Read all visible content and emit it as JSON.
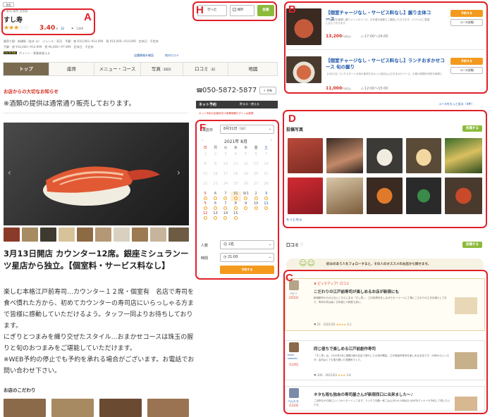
{
  "labels": {
    "A": "A",
    "B": "B",
    "C": "C",
    "D": "D",
    "F": "F",
    "H": "H"
  },
  "header": {
    "badge": "百名",
    "genre": "1 寿司 東京 百名店",
    "name": "すし寿",
    "rating": "3.40",
    "reviews": "32",
    "saves": "1489",
    "line1": "最寄り駅：新橋駅（徒歩 分）　ジャンル：寿司　予算：夜 ¥10,000～¥14,999　昼 ¥10,000～¥14,999　定休日：不定休",
    "line2": "予算：夜 ¥10,000～¥14,999　昼 ¥6,000～¥7,999　定休日：不定休",
    "goto": "Go To Eat",
    "points": "ポイント・食事券使える",
    "edit": "店舗情報を確認",
    "more": "他の口コミ"
  },
  "tabs": [
    {
      "label": "トップ"
    },
    {
      "label": "座席"
    },
    {
      "label": "メニュー・コース"
    },
    {
      "label": "写真",
      "count": "1022"
    },
    {
      "label": "口コミ",
      "count": "32"
    },
    {
      "label": "地図"
    }
  ],
  "notice": {
    "title": "お店からの大切なお知らせ",
    "body": "※酒類の提供は通常通り販売しております。"
  },
  "intro": {
    "title": "3月13日開店 カウンター12席。銀座ミシュランーツ星店から独立。【個室料・サービス料なし】",
    "body": "楽しむ本格江戸前寿司…カウンター１２席・個室有　名店で寿司を食べ慣れた方から、初めてカウンターの寿司店にいらっしゃる方まで皆様に感動していただけるよう。タッフ一同よりお待ちしております。\nにぎりとつまみを織り交ぜたスタイル…おまかせコースは珠玉の握りと旬のおつまみをご堪能していただけます。\n※WEB予約の停止でも予約を承れる場合がございます。お電話でお問い合わせ下さい。",
    "kodawari": "お店のこだわり"
  },
  "save_bar": {
    "visited": "行った",
    "saved": "保存",
    "button": "投稿"
  },
  "phone": "050-5872-5877",
  "share": "共有",
  "reserve": {
    "title": "ネット予約",
    "right": "貯まる・使える",
    "notice": "ネット予約の空席状況 ※営業時間ログインは新規"
  },
  "cal": {
    "date_label": "来店日",
    "date_value": "8月31日（火）",
    "month": "2021年 8月",
    "weekdays": [
      "日",
      "月",
      "火",
      "水",
      "木",
      "金",
      "土"
    ],
    "rows": [
      [
        "",
        "",
        "",
        "",
        "",
        "",
        ""
      ],
      [
        "",
        "",
        "",
        "",
        "",
        "",
        ""
      ],
      [
        "",
        "",
        "",
        "",
        "",
        "",
        ""
      ],
      [
        "",
        "",
        "",
        "",
        "",
        "",
        ""
      ],
      [
        "5",
        "6",
        "7",
        "31",
        "9/1",
        "2",
        "3"
      ],
      [
        "5",
        "6",
        "7",
        "8",
        "9",
        "10",
        "11"
      ],
      [
        "12",
        "13",
        "14",
        "15",
        "",
        "",
        ""
      ]
    ],
    "people_label": "人数",
    "people_value": "2名",
    "time_label": "時間",
    "time_value": "21:00",
    "submit": "予約する"
  },
  "courses": [
    {
      "title": "【個室チャージなし・サービス料なし】握り主体コース",
      "desc": "旬の食材を厳選し握りメインのコース。お手頃な価格でご堪能いただけます。1つ1つのご要望に応えております。",
      "price": "13,200",
      "tax": "円(税込)",
      "hours": "17:00～24:00",
      "btn1": "予約する",
      "btn2": "コース詳細"
    },
    {
      "title": "【個室チャージなし・サービス料なし】ランチおまかせコース 旬の握り",
      "desc": "【4月2日】ランチスタートの旬の食材をぎゅっと詰め込んだおまかせコース。お昼の時間を特別な時間に",
      "price": "11,000",
      "tax": "円(税込)",
      "hours": "12:00～15:00",
      "btn1": "予約する",
      "btn2": "コース詳細"
    }
  ],
  "courses_more": "コースをもっと見る（4件）",
  "photos": {
    "title": "投稿写真",
    "post": "投稿する",
    "more": "もっと見る"
  },
  "kuchikomi": {
    "title": "口コミ",
    "post": "投稿する",
    "follow": "好みのあう人をフォローすると、その人のオススメのお店から探せます。"
  },
  "reviews": [
    {
      "tag": "ピックアップ！口コミ",
      "title": "こだわりの江戸前寿司が楽しめるお店が新宿にも",
      "body": "新宿駅内からほど近いこちらにある「すし寿」。江戸前寿司をしながらも一つ一つに丁寧にこだわりの工夫を凝らしており、寿司の質は高く日本酒との相性も良い。",
      "user": "ノビー",
      "user_count": "(4152)",
      "score": "4.1",
      "likes": "21",
      "date": "2021/03"
    },
    {
      "tag": "",
      "title": "同じ値ちで楽しめる江戸前創作寿司",
      "body": "「すし寿」は、2020年3月に銀座1席の名店で修行した大将が開店。江戸前創作寿司を楽しめるお店です。20時から入ったが、店内はとても落ち着いた雰囲気でした。",
      "user": "team shotoku",
      "user_count": "(1245)",
      "score": "3.8",
      "likes": "206",
      "date": "2021/03"
    },
    {
      "tag": "",
      "title": "ネタも雨も独自の寿司屋さんが新宿西口に出来ました〜♪",
      "body": "ご近所ながら既にいくつかリピートしてます。ランチでお腹一杯ごはん(R3.8.15時点3,400円)ディナーも予約して伺いたいです。",
      "user": "ぺんたろ",
      "user_count": "(1224)",
      "score": "4.0",
      "likes": "",
      "date": ""
    }
  ],
  "colors": {
    "accent_red": "#e0202a",
    "green": "#8cbb3c",
    "orange": "#f39a1e",
    "link_blue": "#1a55a8",
    "tab_active": "#7a6a50"
  }
}
